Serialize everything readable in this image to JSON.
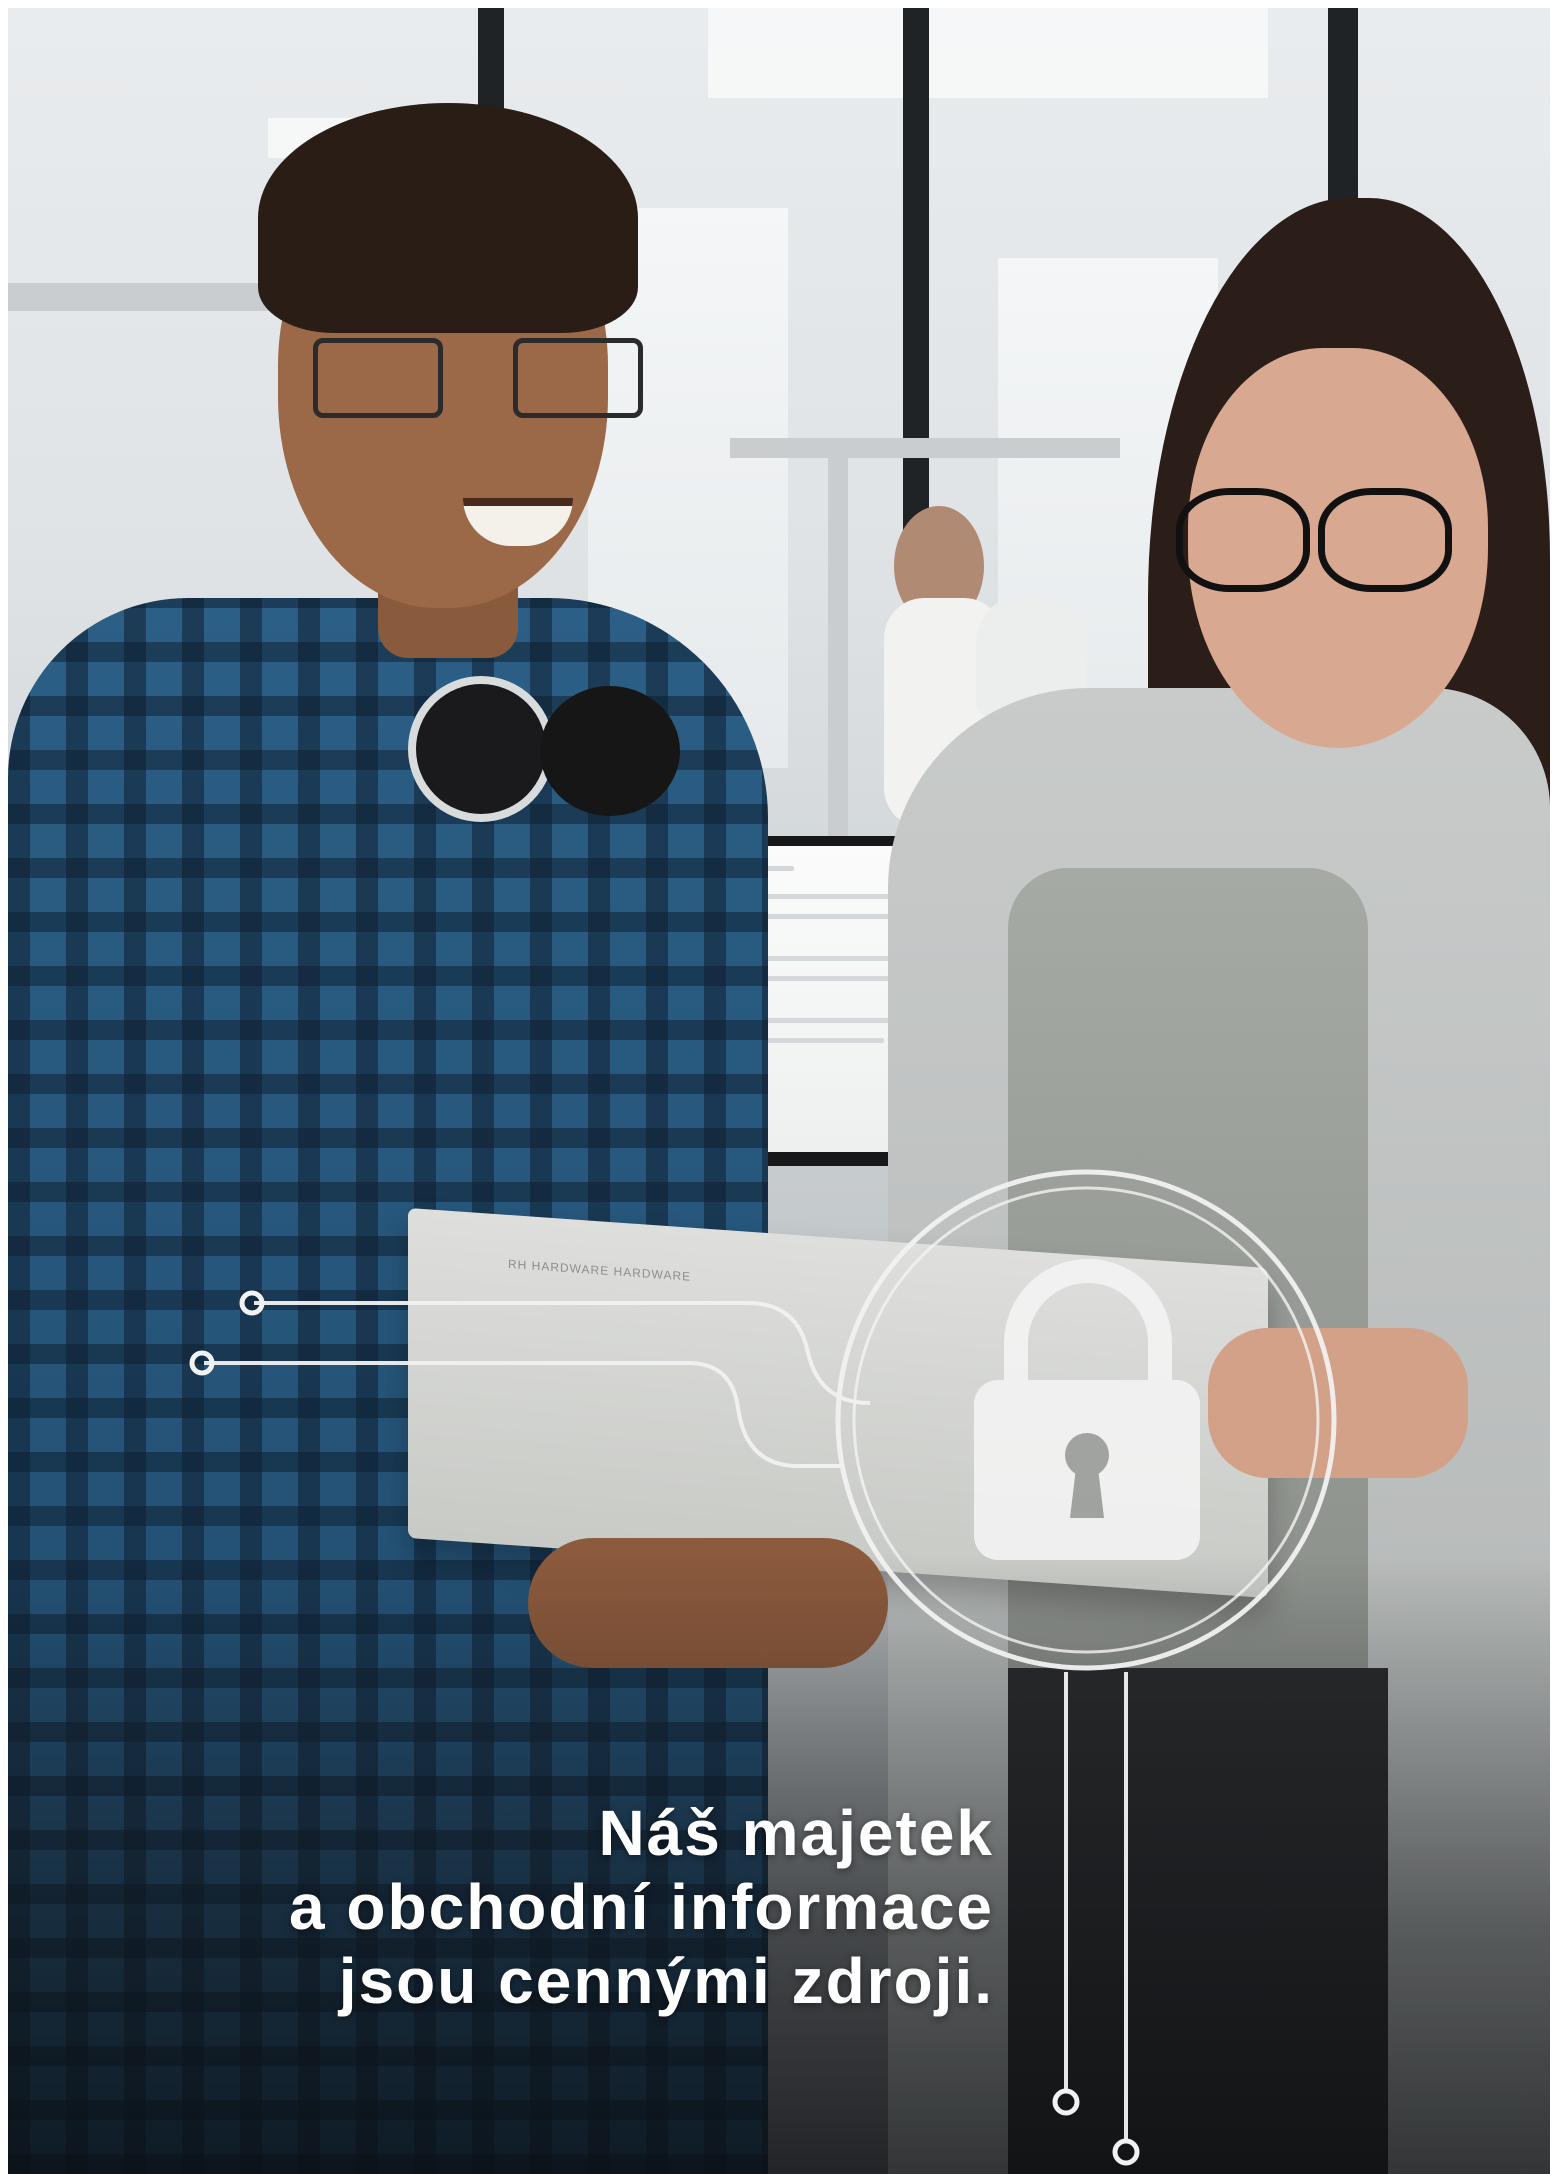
{
  "headline": {
    "line1": "Náš majetek",
    "line2": "a obchodní informace",
    "line3": "jsou cennými zdroji."
  },
  "laptop_label": "RH HARDWARE HARDWARE",
  "icons": {
    "main": "padlock-icon",
    "frame": "circuit-lines-graphic"
  },
  "colors": {
    "headline": "#ffffff",
    "graphic_lines": "#f2f2f2"
  }
}
